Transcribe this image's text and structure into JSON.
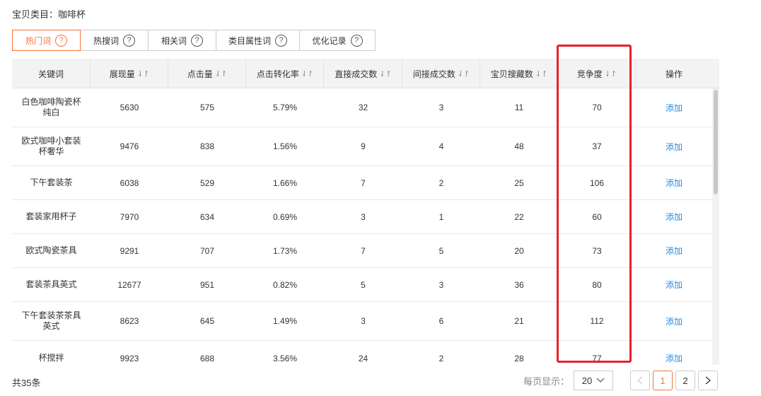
{
  "category": {
    "text": "宝贝类目：咖啡杯"
  },
  "tabs": [
    {
      "label": "热门词",
      "active": true
    },
    {
      "label": "热搜词",
      "active": false
    },
    {
      "label": "相关词",
      "active": false
    },
    {
      "label": "类目属性词",
      "active": false
    },
    {
      "label": "优化记录",
      "active": false
    }
  ],
  "table": {
    "headers": [
      "关键词",
      "展现量",
      "点击量",
      "点击转化率",
      "直接成交数",
      "间接成交数",
      "宝贝搜藏数",
      "竞争度",
      "操作"
    ],
    "sortable": [
      false,
      true,
      true,
      true,
      true,
      true,
      true,
      true,
      false
    ],
    "rows": [
      {
        "keyword": "白色咖啡陶瓷杯纯白",
        "impressions": "5630",
        "clicks": "575",
        "ctr": "5.79%",
        "direct": "32",
        "indirect": "3",
        "favorites": "11",
        "competition": "70",
        "action": "添加"
      },
      {
        "keyword": "欧式咖啡小套装杯奢华",
        "impressions": "9476",
        "clicks": "838",
        "ctr": "1.56%",
        "direct": "9",
        "indirect": "4",
        "favorites": "48",
        "competition": "37",
        "action": "添加"
      },
      {
        "keyword": "下午套装茶",
        "impressions": "6038",
        "clicks": "529",
        "ctr": "1.66%",
        "direct": "7",
        "indirect": "2",
        "favorites": "25",
        "competition": "106",
        "action": "添加"
      },
      {
        "keyword": "套装家用杯子",
        "impressions": "7970",
        "clicks": "634",
        "ctr": "0.69%",
        "direct": "3",
        "indirect": "1",
        "favorites": "22",
        "competition": "60",
        "action": "添加"
      },
      {
        "keyword": "欧式陶瓷茶具",
        "impressions": "9291",
        "clicks": "707",
        "ctr": "1.73%",
        "direct": "7",
        "indirect": "5",
        "favorites": "20",
        "competition": "73",
        "action": "添加"
      },
      {
        "keyword": "套装茶具英式",
        "impressions": "12677",
        "clicks": "951",
        "ctr": "0.82%",
        "direct": "5",
        "indirect": "3",
        "favorites": "36",
        "competition": "80",
        "action": "添加"
      },
      {
        "keyword": "下午套装茶茶具英式",
        "impressions": "8623",
        "clicks": "645",
        "ctr": "1.49%",
        "direct": "3",
        "indirect": "6",
        "favorites": "21",
        "competition": "112",
        "action": "添加"
      },
      {
        "keyword": "杯搅拌",
        "impressions": "9923",
        "clicks": "688",
        "ctr": "3.56%",
        "direct": "24",
        "indirect": "2",
        "favorites": "28",
        "competition": "77",
        "action": "添加"
      }
    ]
  },
  "footer": {
    "total": "共35条",
    "per_page_label": "每页显示：",
    "per_page_value": "20",
    "pages": [
      "1",
      "2"
    ],
    "current_page": "1"
  },
  "colors": {
    "accent": "#f0743a",
    "link": "#2a8be0",
    "highlight": "#e8202a"
  }
}
